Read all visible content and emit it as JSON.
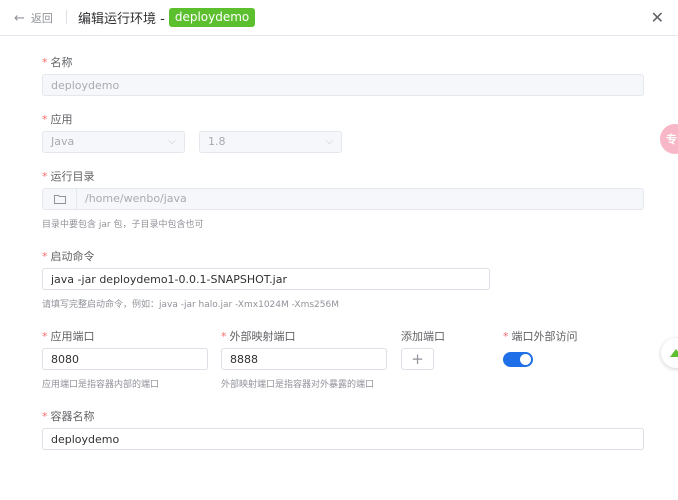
{
  "header": {
    "back_label": "返回",
    "title": "编辑运行环境 -",
    "app_tag": "deploydemo"
  },
  "form": {
    "name": {
      "label": "名称",
      "value": "deploydemo"
    },
    "app": {
      "label": "应用",
      "language": "Java",
      "version": "1.8"
    },
    "run_dir": {
      "label": "运行目录",
      "value": "/home/wenbo/java",
      "hint": "目录中要包含 jar 包，子目录中包含也可"
    },
    "start_cmd": {
      "label": "启动命令",
      "value": "java -jar deploydemo1-0.0.1-SNAPSHOT.jar",
      "hint": "请填写完整启动命令，例如：java -jar halo.jar -Xmx1024M -Xms256M"
    },
    "app_port": {
      "label": "应用端口",
      "value": "8080",
      "hint": "应用端口是指容器内部的端口"
    },
    "ext_port": {
      "label": "外部映射端口",
      "value": "8888",
      "hint": "外部映射端口是指容器对外暴露的端口"
    },
    "add_port": {
      "label": "添加端口",
      "button": "+"
    },
    "ext_access": {
      "label": "端口外部访问",
      "enabled": true
    },
    "container": {
      "label": "容器名称",
      "value": "deploydemo"
    }
  },
  "float": {
    "pink_text": "专"
  },
  "colors": {
    "primary": "#1e6fe8",
    "tag_green": "#5cc02e",
    "required": "#f56c6c"
  }
}
